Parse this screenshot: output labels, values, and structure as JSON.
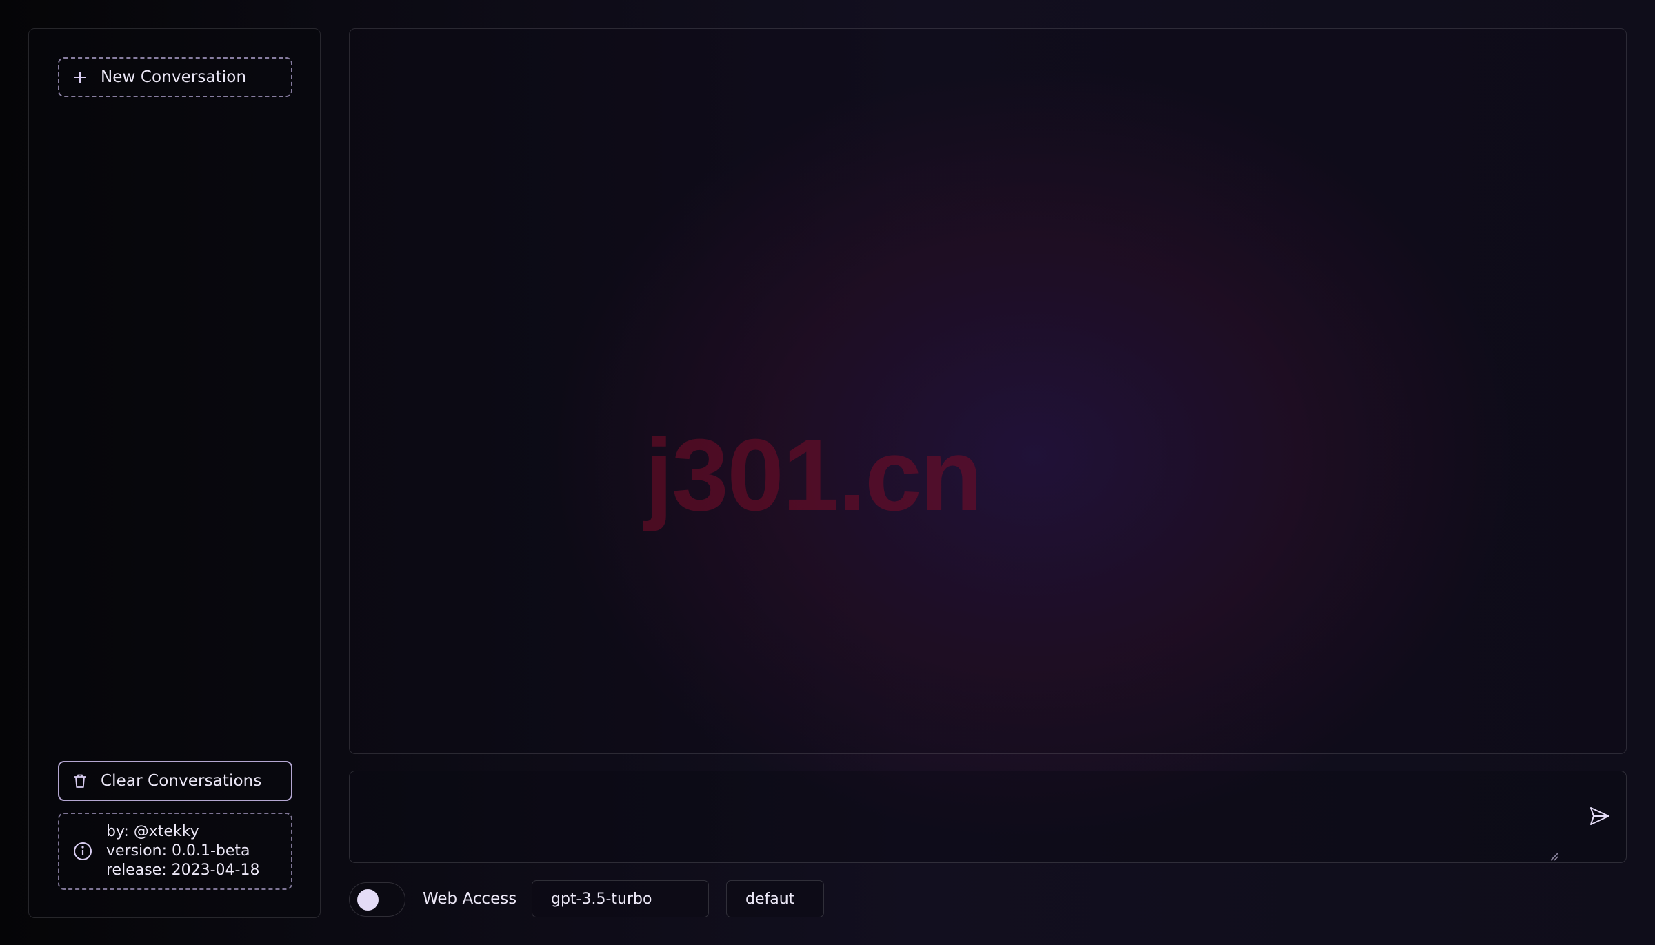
{
  "sidebar": {
    "new_conversation_label": "New Conversation",
    "clear_conversations_label": "Clear Conversations",
    "info": {
      "by": "by: @xtekky",
      "version": "version: 0.0.1-beta",
      "release": "release: 2023-04-18"
    }
  },
  "chat": {
    "watermark": "j301.cn",
    "input_value": "",
    "input_placeholder": ""
  },
  "controls": {
    "web_access_label": "Web Access",
    "web_access_enabled": false,
    "model_selected": "gpt-3.5-turbo",
    "persona_selected": "defaut"
  },
  "icons": {
    "new": "plus-icon",
    "clear": "trash-icon",
    "info": "info-icon",
    "send": "send-icon"
  },
  "colors": {
    "accent": "#e4dcf6",
    "watermark": "#780c28"
  }
}
